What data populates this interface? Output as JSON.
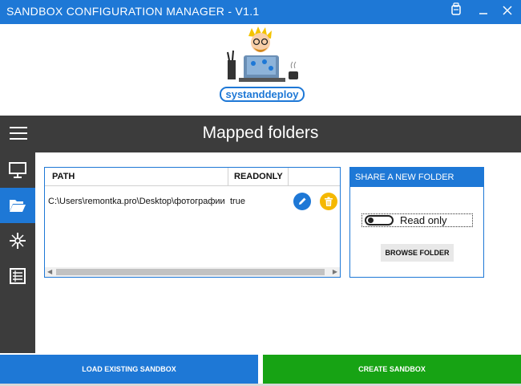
{
  "window": {
    "title": "SANDBOX CONFIGURATION MANAGER - V1.1",
    "controls": [
      "app-icon",
      "minimize-icon",
      "close-icon"
    ]
  },
  "logo": {
    "text": "systanddeploy",
    "brand_color": "#1e78d6"
  },
  "header": {
    "title": "Mapped folders",
    "menu_icon": "hamburger-icon"
  },
  "sidebar": {
    "items": [
      {
        "icon": "monitor-icon",
        "active": false
      },
      {
        "icon": "folder-open-icon",
        "active": true
      },
      {
        "icon": "network-icon",
        "active": false
      },
      {
        "icon": "list-icon",
        "active": false
      }
    ],
    "active_color": "#1e78d6"
  },
  "grid": {
    "columns": [
      "PATH",
      "READONLY"
    ],
    "rows": [
      {
        "path": "C:\\Users\\remontka.pro\\Desktop\\фотографии",
        "readonly": "true"
      }
    ],
    "row_actions": [
      {
        "icon": "edit-icon",
        "color": "#1e78d6"
      },
      {
        "icon": "trash-icon",
        "color": "#f5b800"
      }
    ]
  },
  "share": {
    "title": "SHARE A NEW FOLDER",
    "toggle_label": "Read only",
    "toggle_on": false,
    "browse_label": "BROWSE FOLDER"
  },
  "footer": {
    "load_label": "LOAD EXISTING SANDBOX",
    "create_label": "CREATE SANDBOX",
    "load_color": "#1e78d6",
    "create_color": "#17a314"
  }
}
